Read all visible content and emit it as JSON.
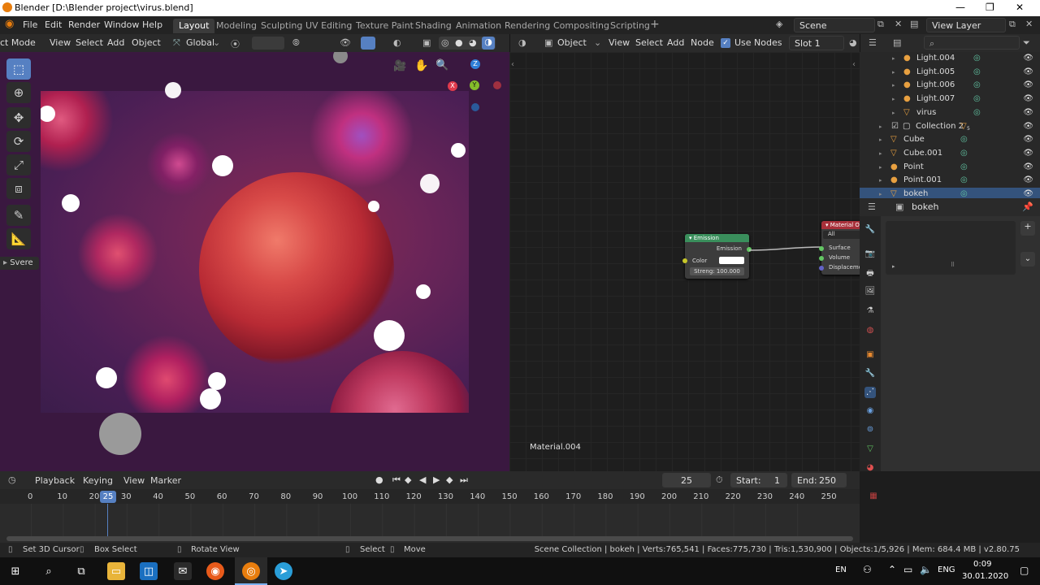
{
  "window": {
    "title": "Blender [D:\\Blender project\\virus.blend]"
  },
  "menu": [
    "File",
    "Edit",
    "Render",
    "Window",
    "Help"
  ],
  "workspaces": [
    "Layout",
    "Modeling",
    "Sculpting",
    "UV Editing",
    "Texture Paint",
    "Shading",
    "Animation",
    "Rendering",
    "Compositing",
    "Scripting"
  ],
  "active_workspace": "Layout",
  "scene": {
    "name": "Scene",
    "view_layer": "View Layer"
  },
  "viewport_header": {
    "mode": "ct Mode",
    "view": "View",
    "select": "Select",
    "add": "Add",
    "object": "Object",
    "orientation": "Global"
  },
  "viewport": {
    "sidebar_tab": "Svere",
    "axes": {
      "x": "X",
      "y": "Y",
      "z": "Z"
    }
  },
  "node_header": {
    "editor_type": "Object",
    "view": "View",
    "select": "Select",
    "add": "Add",
    "node": "Node",
    "use_nodes": "Use Nodes",
    "slot": "Slot 1"
  },
  "node_editor": {
    "material_label": "Material.004",
    "emission_node": {
      "title": "Emission",
      "output": "Emission",
      "color_label": "Color",
      "strength": "Streng: 100.000"
    },
    "output_node": {
      "title": "Material Ou",
      "target": "All",
      "inputs": [
        "Surface",
        "Volume",
        "Displaceme"
      ]
    }
  },
  "outliner": {
    "rows": [
      {
        "name": "Light.004",
        "type": "light",
        "indent": 2,
        "icon_color": "#e8a040"
      },
      {
        "name": "Light.005",
        "type": "light",
        "indent": 2,
        "icon_color": "#e8a040"
      },
      {
        "name": "Light.006",
        "type": "light",
        "indent": 2,
        "icon_color": "#e8a040"
      },
      {
        "name": "Light.007",
        "type": "light",
        "indent": 2,
        "icon_color": "#e8a040"
      },
      {
        "name": "virus",
        "type": "mesh",
        "indent": 2,
        "icon_color": "#e8a040"
      },
      {
        "name": "Collection 2",
        "type": "collection",
        "indent": 1,
        "icon_color": "#dcdcdc",
        "badge": "5"
      },
      {
        "name": "Cube",
        "type": "mesh",
        "indent": 1,
        "icon_color": "#e8a040"
      },
      {
        "name": "Cube.001",
        "type": "mesh",
        "indent": 1,
        "icon_color": "#e8a040"
      },
      {
        "name": "Point",
        "type": "light",
        "indent": 1,
        "icon_color": "#e8a040"
      },
      {
        "name": "Point.001",
        "type": "light",
        "indent": 1,
        "icon_color": "#e8a040"
      },
      {
        "name": "bokeh",
        "type": "mesh",
        "indent": 1,
        "icon_color": "#e8a040",
        "selected": true
      }
    ]
  },
  "properties": {
    "object_name": "bokeh"
  },
  "timeline": {
    "menus": [
      "Playback",
      "Keying",
      "View",
      "Marker"
    ],
    "current_frame": "25",
    "start_label": "Start:",
    "start": "1",
    "end_label": "End:",
    "end": "250",
    "ticks": [
      "0",
      "10",
      "20",
      "30",
      "40",
      "50",
      "60",
      "70",
      "80",
      "90",
      "100",
      "110",
      "120",
      "130",
      "140",
      "150",
      "160",
      "170",
      "180",
      "190",
      "200",
      "210",
      "220",
      "230",
      "240",
      "250"
    ],
    "frame_marker": "25"
  },
  "statusbar": {
    "left": [
      "Set 3D Cursor",
      "Box Select",
      "Rotate View",
      "Select",
      "Move"
    ],
    "right": "Scene Collection | bokeh | Verts:765,541 | Faces:775,730 | Tris:1,530,900 | Objects:1/5,926 | Mem: 684.4 MB | v2.80.75"
  },
  "taskbar": {
    "lang_short": "EN",
    "lang": "ENG",
    "time": "0:09",
    "date": "30.01.2020"
  },
  "colors": {
    "accent": "#5680c2",
    "selection": "#34537c",
    "emission_header": "#3a8f5c",
    "output_header": "#a8303a"
  }
}
